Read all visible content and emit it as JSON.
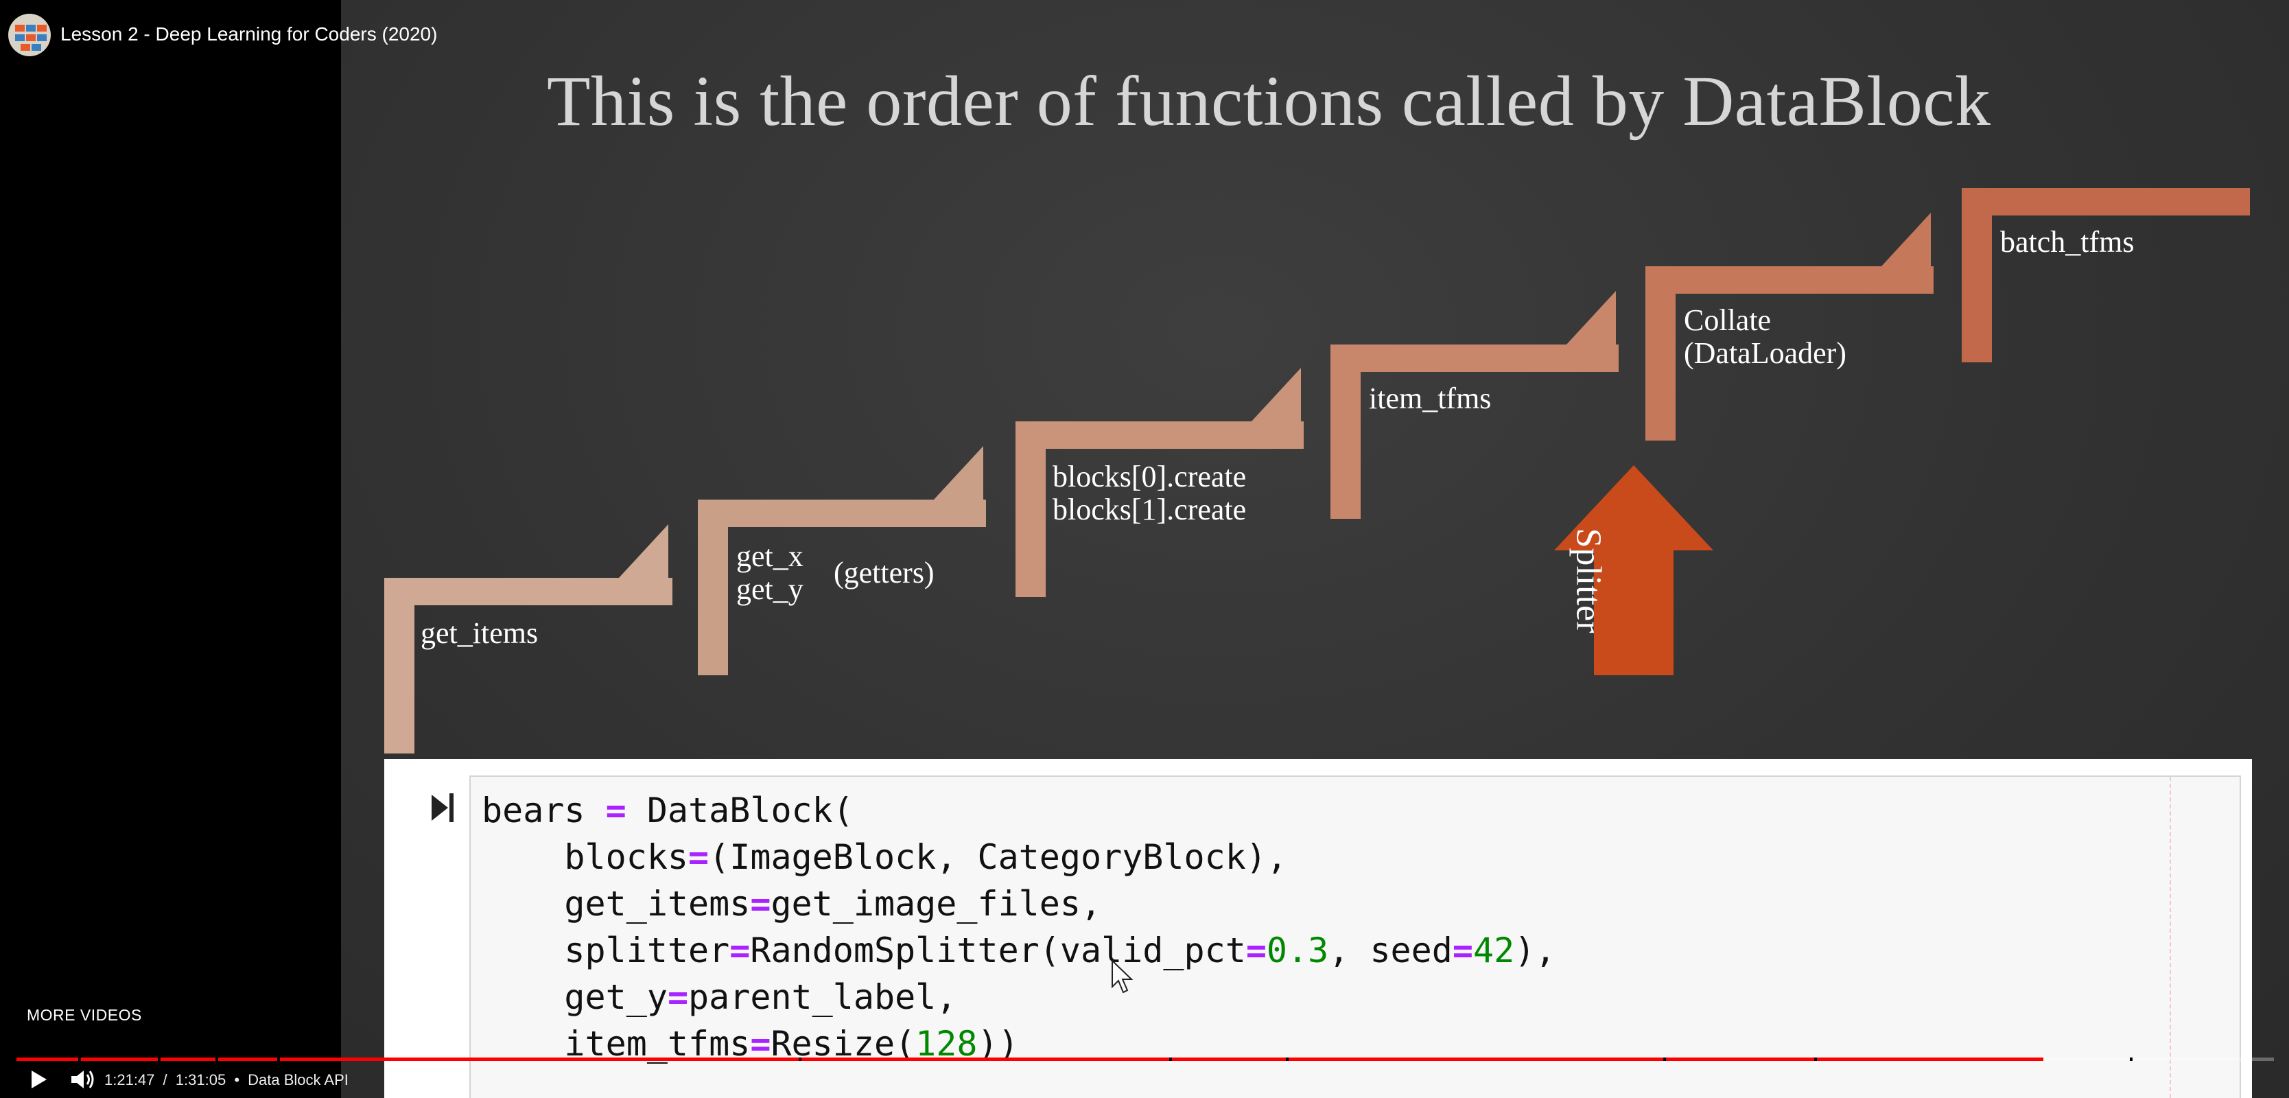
{
  "video": {
    "title": "Lesson 2 - Deep Learning for Coders (2020)",
    "current_time": "1:21:47",
    "duration": "1:31:05",
    "separator": "/",
    "bullet": "•",
    "chapter": "Data Block API",
    "progress_fraction": 0.898
  },
  "overlay": {
    "more_videos": "MORE VIDEOS"
  },
  "slide": {
    "title": "This is the order of functions called by DataBlock",
    "steps": [
      {
        "lines": [
          "get_items"
        ]
      },
      {
        "lines": [
          "get_x",
          "get_y"
        ],
        "aside": "(getters)"
      },
      {
        "lines": [
          "blocks[0].create",
          "blocks[1].create"
        ]
      },
      {
        "lines": [
          "item_tfms"
        ]
      },
      {
        "lines": [
          "Collate",
          "(DataLoader)"
        ]
      },
      {
        "lines": [
          "batch_tfms"
        ]
      }
    ],
    "splitter_label": "Splitter",
    "colors": {
      "step_light": "#caa48f",
      "step_dark": "#c25f3c",
      "splitter": "#c94a1b"
    }
  },
  "code": {
    "lines": [
      [
        {
          "t": "bears "
        },
        {
          "t": "=",
          "c": "op"
        },
        {
          "t": " DataBlock("
        }
      ],
      [
        {
          "t": "    blocks"
        },
        {
          "t": "=",
          "c": "op"
        },
        {
          "t": "(ImageBlock, CategoryBlock),"
        }
      ],
      [
        {
          "t": "    get_items"
        },
        {
          "t": "=",
          "c": "op"
        },
        {
          "t": "get_image_files,"
        }
      ],
      [
        {
          "t": "    splitter"
        },
        {
          "t": "=",
          "c": "op"
        },
        {
          "t": "RandomSplitter(valid_pct"
        },
        {
          "t": "=",
          "c": "op"
        },
        {
          "t": "0.3",
          "c": "num"
        },
        {
          "t": ", seed"
        },
        {
          "t": "=",
          "c": "op"
        },
        {
          "t": "42",
          "c": "num"
        },
        {
          "t": "),"
        }
      ],
      [
        {
          "t": "    get_y"
        },
        {
          "t": "=",
          "c": "op"
        },
        {
          "t": "parent_label,"
        }
      ],
      [
        {
          "t": "    item_tfms"
        },
        {
          "t": "=",
          "c": "op"
        },
        {
          "t": "Resize("
        },
        {
          "t": "128",
          "c": "num"
        },
        {
          "t": "))"
        }
      ]
    ]
  },
  "icons": {
    "play": "play-icon",
    "volume": "volume-icon",
    "run_cell": "run-cell-icon",
    "cursor": "mouse-cursor-icon"
  }
}
